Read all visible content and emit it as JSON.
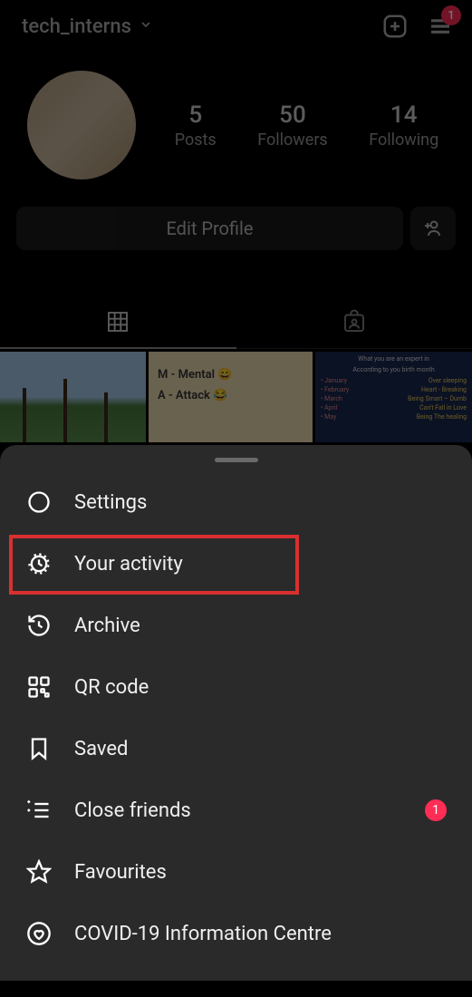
{
  "header": {
    "username": "tech_interns",
    "menu_badge": "1"
  },
  "profile": {
    "stats": [
      {
        "count": "5",
        "label": "Posts"
      },
      {
        "count": "50",
        "label": "Followers"
      },
      {
        "count": "14",
        "label": "Following"
      }
    ]
  },
  "actions": {
    "edit_label": "Edit Profile"
  },
  "posts": {
    "post2_line1": "M - Mental 😄",
    "post2_line2": "A - Attack 😂",
    "post3_header1": "What you are an expert in",
    "post3_header2": "According to you birth month",
    "post3_rows": [
      {
        "month": "• January",
        "text": "Over sleeping"
      },
      {
        "month": "• February",
        "text": "Heart - Breaking"
      },
      {
        "month": "• March",
        "text": "Being Smart – Dumb"
      },
      {
        "month": "• April",
        "text": "Can't Fall in Love"
      },
      {
        "month": "• May",
        "text": "Being The healing"
      }
    ]
  },
  "menu": {
    "settings": "Settings",
    "activity": "Your activity",
    "archive": "Archive",
    "qr": "QR code",
    "saved": "Saved",
    "close_friends": "Close friends",
    "close_friends_badge": "1",
    "favourites": "Favourites",
    "covid": "COVID-19 Information Centre"
  }
}
